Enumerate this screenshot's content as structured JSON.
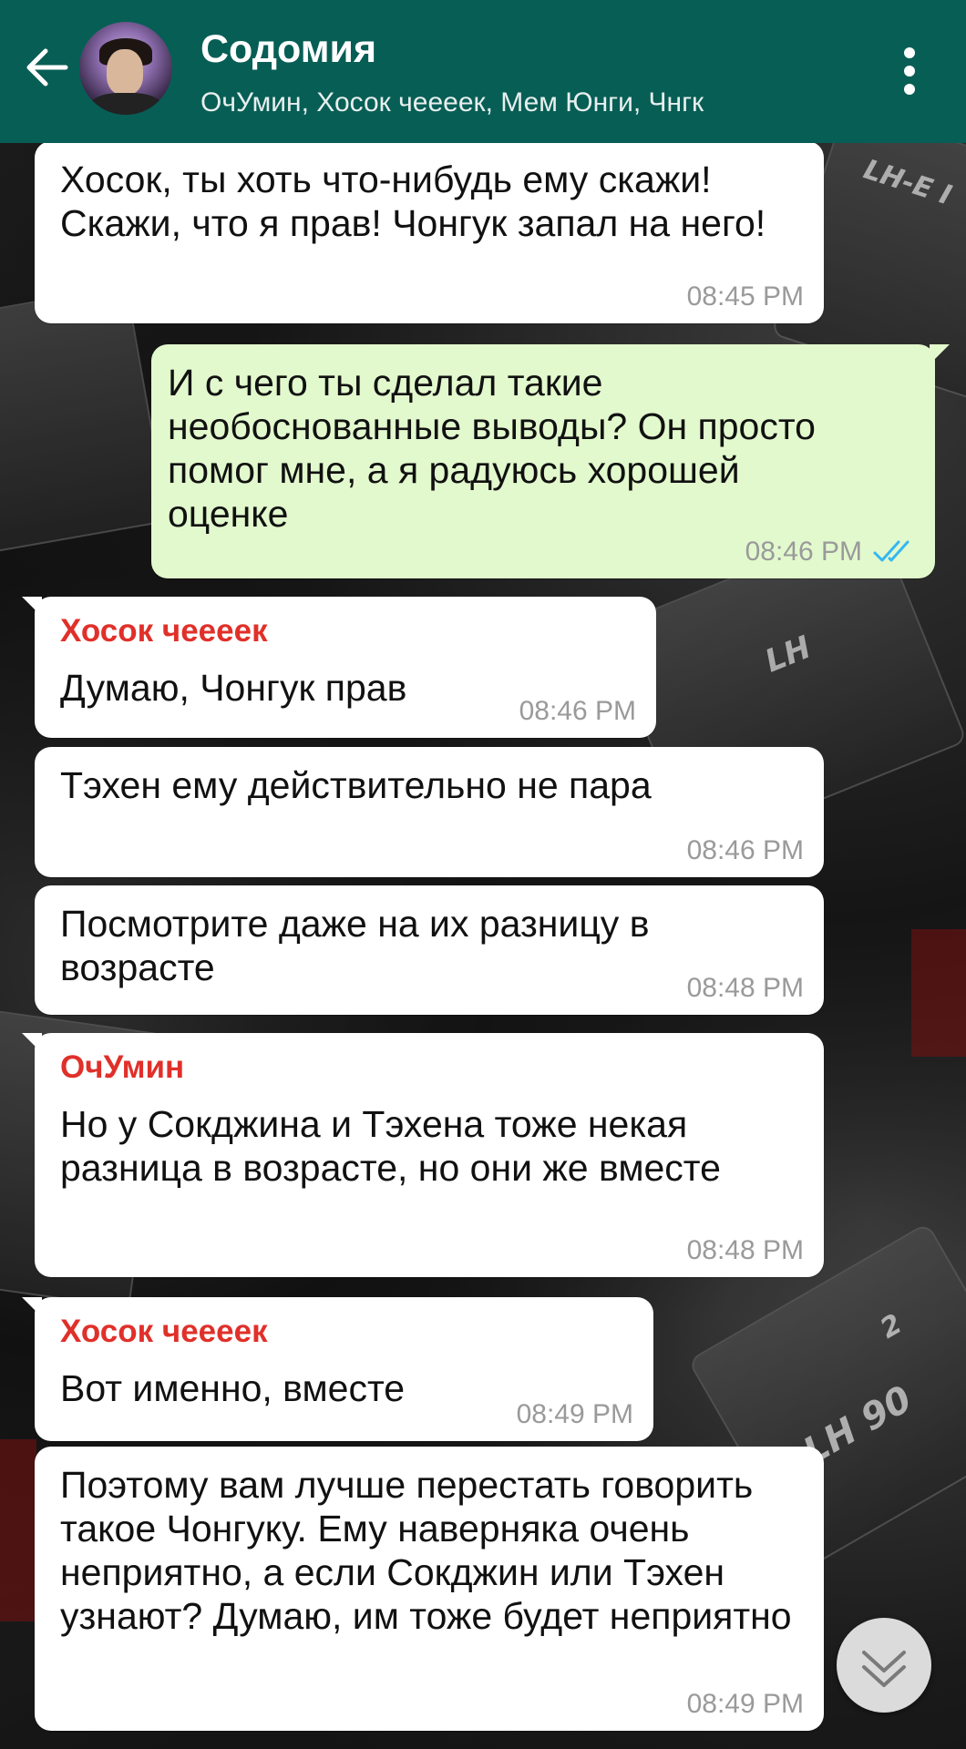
{
  "header": {
    "title": "Содомия",
    "subtitle": "ОчУмин, Хосок чеееек, Мем Юнги, Чнгк",
    "bg_color": "#075e55"
  },
  "messages": [
    {
      "direction": "in",
      "sender": "",
      "text": "Хосок, ты хоть что-нибудь ему скажи! Скажи, что я прав! Чонгук запал на него!",
      "time": "08:45 PM"
    },
    {
      "direction": "out",
      "sender": "",
      "text": "И с чего ты сделал такие необоснованные выводы? Он просто помог мне, а я радуюсь хорошей оценке",
      "time": "08:46 PM",
      "status": "read"
    },
    {
      "direction": "in",
      "sender": "Хосок чеееек",
      "text": "Думаю, Чонгук прав",
      "time": "08:46 PM"
    },
    {
      "direction": "in",
      "sender": "",
      "text": "Тэхен ему действительно не пара",
      "time": "08:46 PM"
    },
    {
      "direction": "in",
      "sender": "",
      "text": "Посмотрите даже на их разницу в возрасте",
      "time": "08:48 PM"
    },
    {
      "direction": "in",
      "sender": "ОчУмин",
      "text": "Но у Сокджина и Тэхена тоже некая разница в возрасте, но они же вместе",
      "time": "08:48 PM"
    },
    {
      "direction": "in",
      "sender": "Хосок чеееек",
      "text": "Вот именно, вместе",
      "time": "08:49 PM"
    },
    {
      "direction": "in",
      "sender": "",
      "text": "Поэтому вам лучше перестать говорить такое Чонгуку. Ему наверняка очень неприятно, а если Сокджин или Тэхен узнают? Думаю, им тоже будет неприятно",
      "time": "08:49 PM"
    }
  ],
  "wallpaper_labels": {
    "tape1": "LH-E I",
    "tape2": "LH",
    "tape3": "LH 90",
    "tape3_num": "2"
  },
  "colors": {
    "incoming_bubble": "#ffffff",
    "outgoing_bubble": "#e2f9cd",
    "sender_name": "#e0302a",
    "read_ticks": "#34b7f1"
  },
  "icons": {
    "back": "arrow-left-icon",
    "menu": "more-vertical-icon",
    "scroll": "chevron-double-down-icon",
    "status": "double-check-icon"
  }
}
